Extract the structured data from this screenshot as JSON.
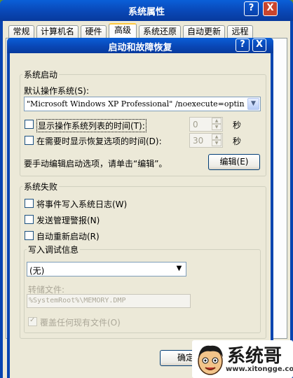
{
  "outer": {
    "title": "系统属性",
    "tabs": [
      "常规",
      "计算机名",
      "硬件",
      "高级",
      "系统还原",
      "自动更新",
      "远程"
    ],
    "help_glyph": "?",
    "close_glyph": "X"
  },
  "dialog": {
    "title": "启动和故障恢复",
    "help_glyph": "?",
    "close_glyph": "X",
    "startup": {
      "group_label": "系统启动",
      "default_os_label": "默认操作系统(S):",
      "default_os_value": "\"Microsoft Windows XP Professional\" /noexecute=optin",
      "show_list_label": "显示操作系统列表的时间(T):",
      "show_list_value": "0",
      "show_recovery_label": "在需要时显示恢复选项的时间(D):",
      "show_recovery_value": "30",
      "seconds_unit": "秒",
      "manual_edit_text": "要手动编辑启动选项，请单击“编辑”。",
      "edit_button": "编辑(E)"
    },
    "failure": {
      "group_label": "系统失败",
      "write_event_label": "将事件写入系统日志(W)",
      "send_alert_label": "发送管理警报(N)",
      "auto_restart_label": "自动重新启动(R)",
      "debug_group_label": "写入调试信息",
      "debug_value": "(无)",
      "dump_file_label": "转储文件:",
      "dump_file_value": "%SystemRoot%\\MEMORY.DMP",
      "overwrite_label": "覆盖任何现有文件(O)"
    },
    "ok_button": "确定"
  },
  "watermark": {
    "brand": "系统哥",
    "url": "www.xitongge.com"
  },
  "colors": {
    "title_blue": "#0947b6",
    "dialog_face": "#ece9d8",
    "selected_tab_accent": "#ffc83c"
  }
}
